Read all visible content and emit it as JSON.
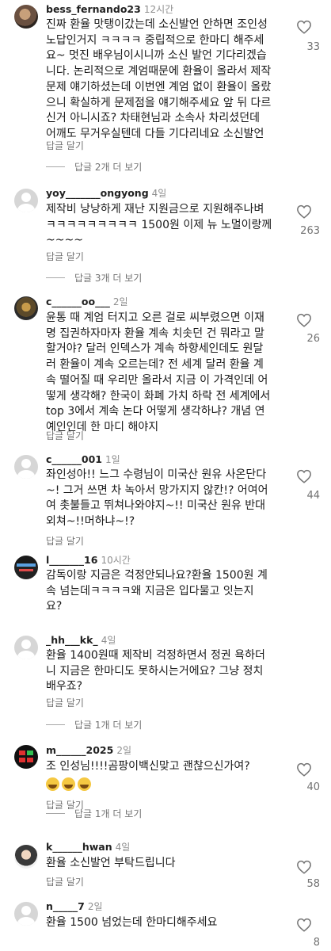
{
  "comments": [
    {
      "username": "bess_fernando23",
      "time": "12시간",
      "text": "진짜 환율 맛탱이갔는데 소신발언 안하면 조인성\n노답인거지 ㅋㅋㅋㅋ 중립적으로 한마디 해주세\n요~ 멋진 배우님이시니까 소신 발언 기다리겠습\n니다. 논리적으로 계엄때문에 환율이 올라서 제작\n문제 얘기하셨는데 이번엔 계엄 없이 환율이 올랐\n으니 확실하게 문제점을 얘기해주세요 앞 뒤 다르\n신거 아니시죠? 차태현님과 소속사 차리셨던데\n어깨도 무거우실텐데 다들 기다리네요 소신발언",
      "reply": "답글 달기",
      "more": "답글 2개 더 보기",
      "likes": "33"
    },
    {
      "username": "yoy_______ongyong",
      "time": "4일",
      "text": "제작비 낭낭하게 재난 지원금으로 지원해주나벼\nㅋㅋㅋㅋㅋㅋㅋㅋㅋ 1500원 이제 뉴 노멀이랑께\n~~~~",
      "reply": "답글 달기",
      "more": "답글 3개 더 보기",
      "likes": "263"
    },
    {
      "username": "c______oo___",
      "time": "2일",
      "text": "윤통 때 계엄 터지고 오른 걸로 씨부렸으면 이재\n명 집권하자마자 환율 계속 치솟던 건 뭐라고 말\n할거야? 달러 인덱스가 계속 하향세인데도 원달\n러 환율이 계속 오르는데? 전 세계 달러 환율 계\n속 떨어질 때 우리만 올라서 지금 이 가격인데 어\n떻게 생각해? 한국이 화폐 가치 하락 전 세계에서\ntop 3에서 계속 논다 어떻게 생각하냐? 개념 연\n예인인데 한 마디 해야지",
      "reply": "답글 달기",
      "more": "",
      "likes": "26"
    },
    {
      "username": "c______001",
      "time": "1일",
      "text": "좌인성아!! 느그 수령님이 미국산 원유 사온단다\n~! 그거 쓰면 차 녹아서 망가지지 않칸!? 어여어\n여 촛불들고 뛰쳐나와야지~!! 미국산 원유 반대\n외쳐~!!머하냐~!?",
      "reply": "답글 달기",
      "more": "",
      "likes": "44"
    },
    {
      "username": "l_______16",
      "time": "10시간",
      "text": "감독이랑 지금은 걱정안되나요?환율 1500원 계\n속 넘는데ㅋㅋㅋㅋ왜 지금은 입다물고 잇는지\n요?",
      "reply": "",
      "more": "",
      "likes": ""
    },
    {
      "username": "_hh___kk_",
      "time": "4일",
      "text": "환율 1400원때 제작비 걱정하면서 정권 욕하더\n니 지금은 한마디도 못하시는거에요? 그냥 정치\n배우죠?",
      "reply": "답글 달기",
      "more": "답글 1개 더 보기",
      "likes": ""
    },
    {
      "username": "m______2025",
      "time": "2일",
      "text": "조 인성님!!!!곰팡이백신맞고 괜찮으신가여?",
      "reply": "답글 달기",
      "more": "답글 1개 더 보기",
      "likes": "40"
    },
    {
      "username": "k______hwan",
      "time": "4일",
      "text": "환율 소신발언 부탁드립니다",
      "reply": "답글 달기",
      "more": "",
      "likes": "58"
    },
    {
      "username": "n_____7",
      "time": "2일",
      "text": "환율 1500 넘었는데 한마디해주세요",
      "reply": "",
      "more": "",
      "likes": "8"
    }
  ]
}
